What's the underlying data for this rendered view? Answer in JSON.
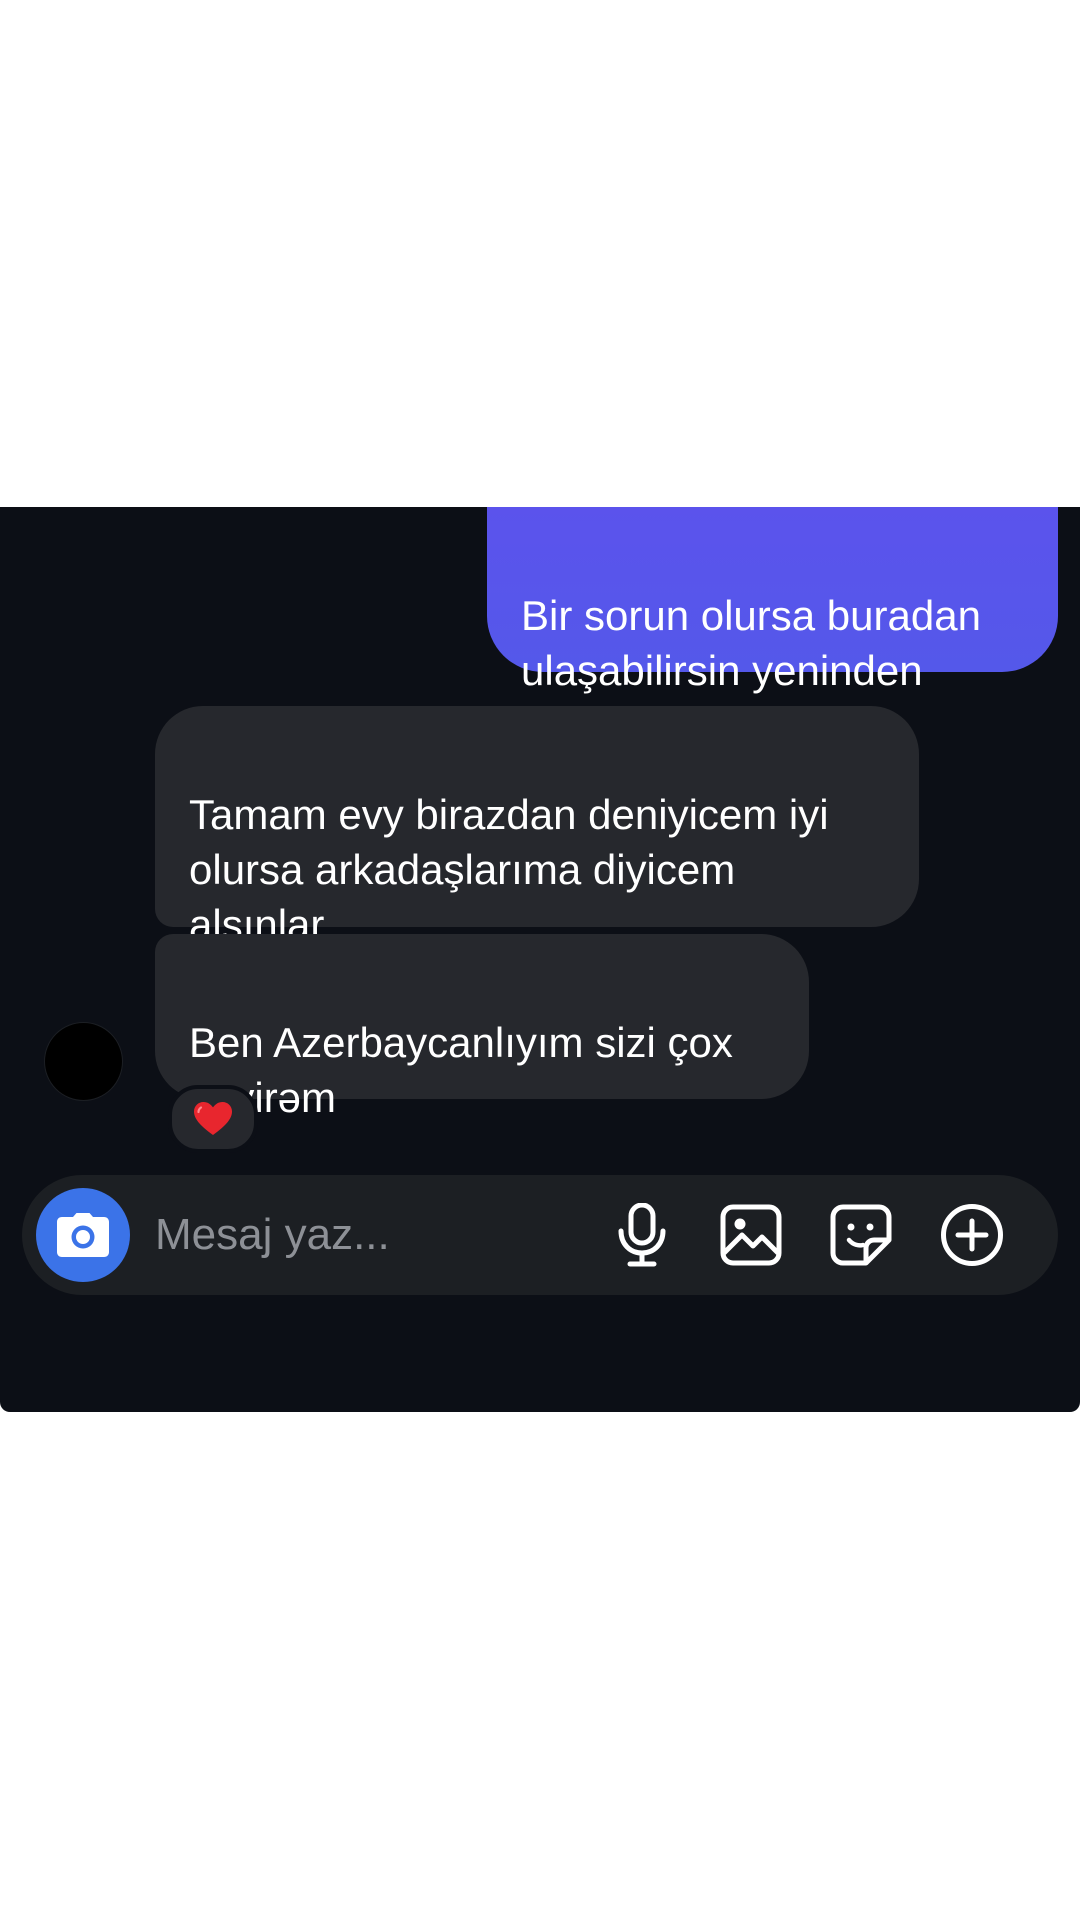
{
  "messages": [
    {
      "direction": "sent",
      "text": "Bir sorun olursa buradan\nulaşabilirsin yeninden"
    },
    {
      "direction": "received",
      "text": "Tamam evy birazdan deniyicem iyi\nolursa arkadaşlarıma diyicem\nalsınlar"
    },
    {
      "direction": "received",
      "text": "Ben Azerbaycanlıyım sizi çox\nsevirəm",
      "reaction": "❤️"
    }
  ],
  "composer": {
    "placeholder": "Mesaj yaz..."
  },
  "colors": {
    "panel_background": "#0c0f16",
    "sent_bubble": "#5856ea",
    "received_bubble": "#26282d",
    "composer_background": "#1c1f23",
    "camera_button": "#3b73e8",
    "reaction_heart": "#e8262e"
  },
  "icons": {
    "camera": "camera-icon",
    "microphone": "microphone-icon",
    "gallery": "gallery-icon",
    "sticker": "sticker-icon",
    "plus": "plus-circle-icon"
  }
}
